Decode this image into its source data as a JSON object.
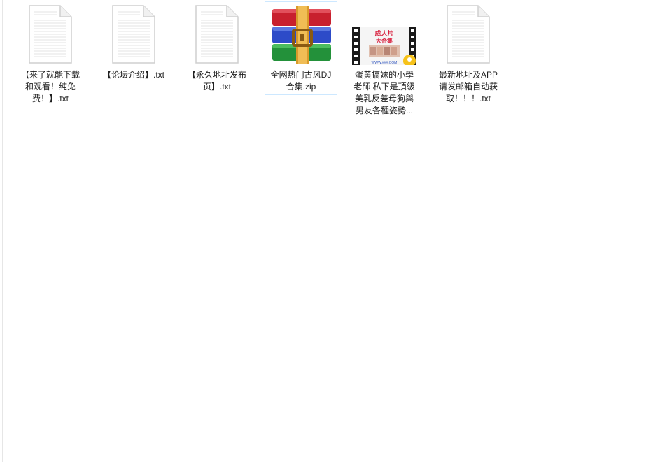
{
  "files": [
    {
      "name": "【来了就能下载和观看！纯免费！】.txt",
      "type": "txt",
      "icon": "text-file-icon"
    },
    {
      "name": "【论坛介绍】.txt",
      "type": "txt",
      "icon": "text-file-icon"
    },
    {
      "name": "【永久地址发布页】.txt",
      "type": "txt",
      "icon": "text-file-icon"
    },
    {
      "name": "全网热门古风DJ合集.zip",
      "type": "zip",
      "icon": "winrar-archive-icon",
      "selected": true
    },
    {
      "name": "蛋黄搞妹的小學老師 私下是頂級美乳反差母狗與男友各種姿勢...",
      "type": "video",
      "icon": "video-thumbnail-icon"
    },
    {
      "name": "最新地址及APP请发邮箱自动获取！！！.txt",
      "type": "txt",
      "icon": "text-file-icon"
    }
  ],
  "colors": {
    "selection_border": "#cde8ff",
    "text": "#1f1f1f",
    "rar_red": "#c8202e",
    "rar_blue": "#2d4bc8",
    "rar_green": "#23913a",
    "rar_belt": "#d99a2b"
  }
}
